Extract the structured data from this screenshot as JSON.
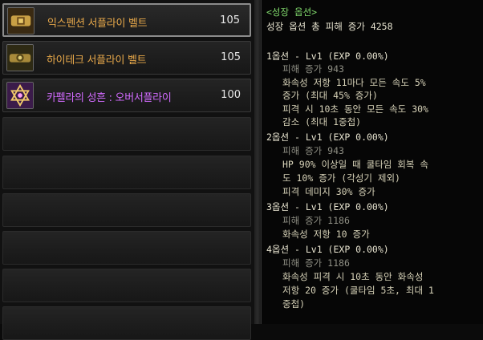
{
  "items": [
    {
      "name": "익스펜션 서플라이 벨트",
      "level": "105",
      "icon": "belt-icon"
    },
    {
      "name": "하이테크 서플라이 벨트",
      "level": "105",
      "icon": "belt-icon"
    },
    {
      "name": "카펠라의 성흔 : 오버서플라이",
      "level": "100",
      "icon": "hexagram-icon"
    }
  ],
  "empty_slots": 6,
  "panel": {
    "title": "<성장 옵션>",
    "total": "성장 옵션 총 피해 증가 4258",
    "opt1_head": "1옵션 - Lv1 (EXP 0.00%)",
    "opt1_dmg": "피해 증가 943",
    "opt1_l1": "화속성 저항 11마다 모든 속도 5%",
    "opt1_l2": "증가 (최대 45% 증가)",
    "opt1_l3": "피격 시 10초 동안 모든 속도 30%",
    "opt1_l4": "감소 (최대 1중첩)",
    "opt2_head": "2옵션 - Lv1 (EXP 0.00%)",
    "opt2_dmg": "피해 증가 943",
    "opt2_l1": "HP 90% 이상일 때 쿨타임 회복 속",
    "opt2_l2": "도 10% 증가 (각성기 제외)",
    "opt2_l3": "피격 데미지 30% 증가",
    "opt3_head": "3옵션 - Lv1 (EXP 0.00%)",
    "opt3_dmg": "피해 증가 1186",
    "opt3_l1": "화속성 저항 10 증가",
    "opt4_head": "4옵션 - Lv1 (EXP 0.00%)",
    "opt4_dmg": "피해 증가 1186",
    "opt4_l1": "화속성 피격 시 10초 동안 화속성",
    "opt4_l2": "저항 20 증가 (쿨타임 5초, 최대 1",
    "opt4_l3": "중첩)"
  }
}
